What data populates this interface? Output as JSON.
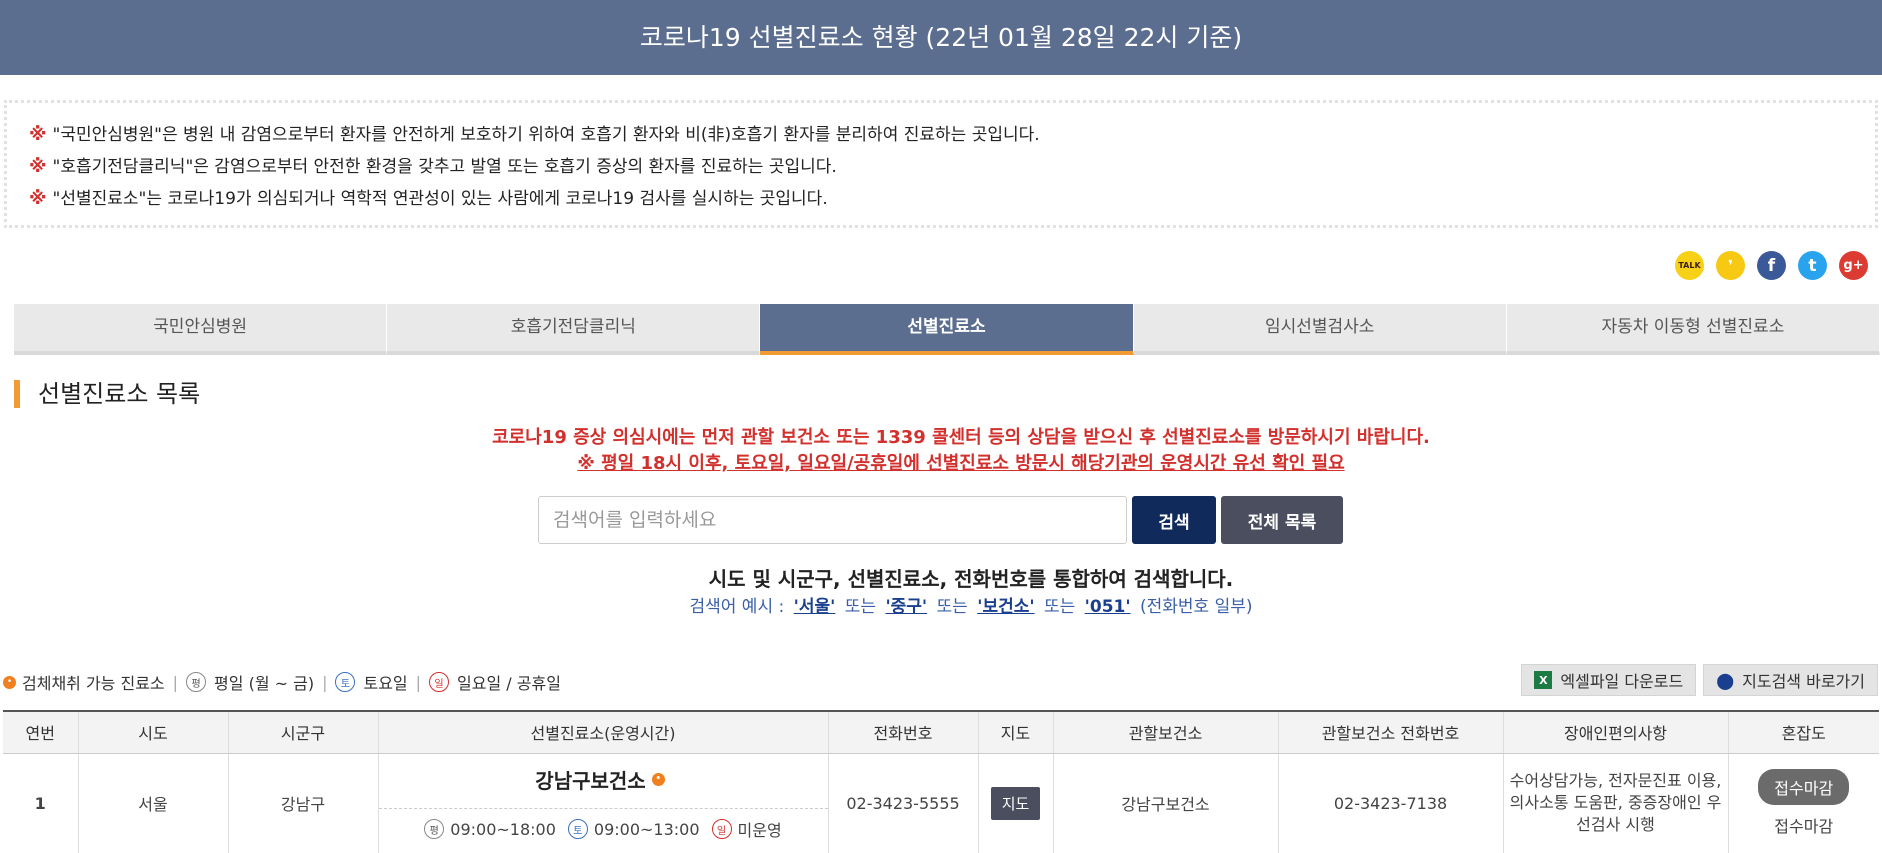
{
  "header": {
    "title": "코로나19 선별진료소 현황 (22년 01월 28일 22시 기준)"
  },
  "notice": {
    "mark": "※",
    "lines": [
      "\"국민안심병원\"은 병원 내 감염으로부터 환자를 안전하게 보호하기 위하여 호흡기 환자와 비(非)호흡기 환자를 분리하여 진료하는 곳입니다.",
      "\"호흡기전담클리닉\"은 감염으로부터 안전한 환경을 갖추고 발열 또는 호흡기 증상의 환자를 진료하는 곳입니다.",
      "\"선별진료소\"는 코로나19가 의심되거나 역학적 연관성이 있는 사람에게 코로나19 검사를 실시하는 곳입니다."
    ]
  },
  "share": [
    {
      "icon": "kakaotalk-icon",
      "label": "TALK",
      "color": "#f7d116"
    },
    {
      "icon": "kakaostory-icon",
      "label": "❜",
      "color": "#f7c912"
    },
    {
      "icon": "facebook-icon",
      "label": "f",
      "color": "#3b5998"
    },
    {
      "icon": "twitter-icon",
      "label": "t",
      "color": "#2aa3ef"
    },
    {
      "icon": "googleplus-icon",
      "label": "g+",
      "color": "#dc3b31"
    }
  ],
  "tabs": [
    {
      "label": "국민안심병원",
      "active": false
    },
    {
      "label": "호흡기전담클리닉",
      "active": false
    },
    {
      "label": "선별진료소",
      "active": true
    },
    {
      "label": "임시선별검사소",
      "active": false
    },
    {
      "label": "자동차 이동형 선별진료소",
      "active": false
    }
  ],
  "section_title": "선별진료소 목록",
  "warnings": {
    "line1": "코로나19 증상 의심시에는 먼저 관할 보건소 또는 1339 콜센터 등의 상담을 받으신 후 선별진료소를 방문하시기 바랍니다.",
    "line2": "※ 평일 18시 이후, 토요일, 일요일/공휴일에 선별진료소 방문시 해당기관의 운영시간 유선 확인 필요"
  },
  "search": {
    "placeholder": "검색어를 입력하세요",
    "search_label": "검색",
    "all_label": "전체 목록",
    "description": "시도 및 시군구, 선별진료소, 전화번호를 통합하여 검색합니다.",
    "example_prefix": "검색어 예시 :",
    "ex1": "'서울'",
    "or1": "또는",
    "ex2": "'중구'",
    "or2": "또는",
    "ex3": "'보건소'",
    "or3": "또는",
    "ex4": "'051'",
    "example_suffix": "(전화번호 일부)"
  },
  "legend": {
    "specimen": "검체채취 가능 진료소",
    "weekday_glyph": "평",
    "weekday": "평일 (월 ~ 금)",
    "saturday_glyph": "토",
    "saturday": "토요일",
    "sunday_glyph": "일",
    "sunday": "일요일 / 공휴일"
  },
  "tools": {
    "excel_label": "엑셀파일 다운로드",
    "map_label": "지도검색 바로가기"
  },
  "table": {
    "headers": [
      "연번",
      "시도",
      "시군구",
      "선별진료소(운영시간)",
      "전화번호",
      "지도",
      "관할보건소",
      "관할보건소 전화번호",
      "장애인편의사항",
      "혼잡도"
    ],
    "rows": [
      {
        "no": "1",
        "sido": "서울",
        "sigungu": "강남구",
        "center_name": "강남구보건소",
        "weekday_hours": "09:00~18:00",
        "saturday_hours": "09:00~13:00",
        "sunday_hours": "미운영",
        "phone": "02-3423-5555",
        "map_label": "지도",
        "health_center": "강남구보건소",
        "health_center_phone": "02-3423-7138",
        "disability": "수어상담가능, 전자문진표 이용, 의사소통 도움판, 중증장애인 우선검사 시행",
        "congestion_badge": "접수마감",
        "congestion_text": "접수마감"
      }
    ]
  }
}
